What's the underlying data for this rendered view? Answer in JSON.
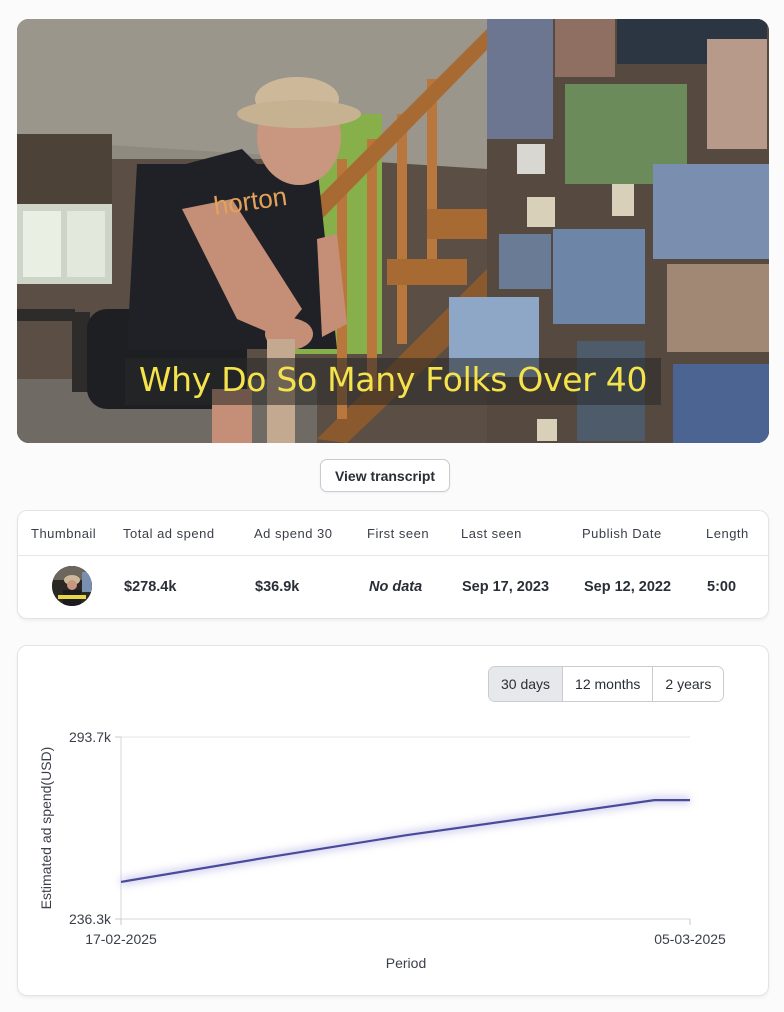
{
  "video": {
    "caption": "Why Do So Many Folks Over 40",
    "shirt_text": "horton"
  },
  "transcript_button": {
    "label": "View transcript"
  },
  "table": {
    "headers": [
      "Thumbnail",
      "Total ad spend",
      "Ad spend 30",
      "First seen",
      "Last seen",
      "Publish Date",
      "Length"
    ],
    "row": {
      "total_ad_spend": "$278.4k",
      "ad_spend_30": "$36.9k",
      "first_seen": "No data",
      "last_seen": "Sep 17, 2023",
      "publish_date": "Sep 12, 2022",
      "length": "5:00"
    }
  },
  "range_tabs": {
    "options": [
      "30 days",
      "12 months",
      "2 years"
    ],
    "selected": "30 days"
  },
  "chart_data": {
    "type": "line",
    "title": "",
    "xlabel": "Period",
    "ylabel": "Estimated ad spend(USD)",
    "x_tick_labels": [
      "17-02-2025",
      "05-03-2025"
    ],
    "y_tick_labels": [
      "293.7k",
      "236.3k"
    ],
    "ylim": [
      236.3,
      293.7
    ],
    "y_unit": "k USD",
    "grid": true,
    "series": [
      {
        "color": "#4a4a9a",
        "points": [
          {
            "x": "17-02-2025",
            "y": 248.0
          },
          {
            "x": "21-02-2025",
            "y": 255.5
          },
          {
            "x": "25-02-2025",
            "y": 262.7
          },
          {
            "x": "01-03-2025",
            "y": 269.0
          },
          {
            "x": "04-03-2025",
            "y": 273.8
          },
          {
            "x": "05-03-2025",
            "y": 273.8
          }
        ]
      }
    ]
  }
}
